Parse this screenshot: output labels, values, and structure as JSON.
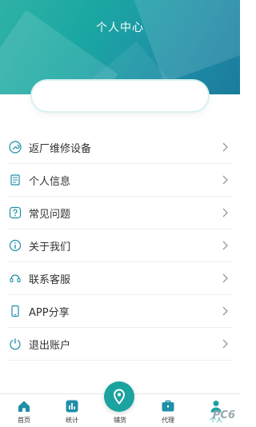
{
  "header": {
    "title": "个人中心"
  },
  "menu": {
    "items": [
      {
        "label": "返厂维修设备",
        "icon": "wrench-icon"
      },
      {
        "label": "个人信息",
        "icon": "document-icon"
      },
      {
        "label": "常见问题",
        "icon": "question-icon"
      },
      {
        "label": "关于我们",
        "icon": "info-icon"
      },
      {
        "label": "联系客服",
        "icon": "headset-icon"
      },
      {
        "label": "APP分享",
        "icon": "phone-icon"
      },
      {
        "label": "退出账户",
        "icon": "power-icon"
      }
    ]
  },
  "tabbar": {
    "tabs": [
      {
        "label": "首页",
        "icon": "home-icon"
      },
      {
        "label": "统计",
        "icon": "chart-icon"
      },
      {
        "label": "铺货",
        "icon": "location-pin-icon"
      },
      {
        "label": "代理",
        "icon": "briefcase-icon"
      },
      {
        "label": "个人",
        "icon": "person-icon"
      }
    ],
    "active": "个人"
  },
  "colors": {
    "accent": "#1aa3a1",
    "header_dark": "#1a7b9c"
  },
  "watermark": "PC6"
}
